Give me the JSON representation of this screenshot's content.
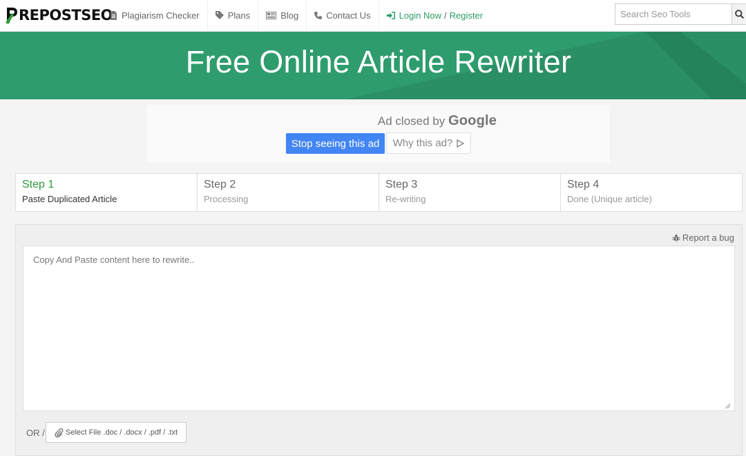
{
  "brand": {
    "logo_text": "REPOSTSEO",
    "logo_mark_color": "#2e9c3a"
  },
  "nav": {
    "items": [
      {
        "label": "Plagiarism Checker",
        "icon": "document-icon"
      },
      {
        "label": "Plans",
        "icon": "tag-icon"
      },
      {
        "label": "Blog",
        "icon": "newspaper-icon"
      },
      {
        "label": "Contact Us",
        "icon": "phone-icon"
      }
    ],
    "login_label": "Login Now",
    "separator": "/",
    "register_label": "Register"
  },
  "search": {
    "placeholder": "Search Seo Tools",
    "value": ""
  },
  "banner": {
    "title": "Free Online Article Rewriter",
    "color": "#2f9c6e"
  },
  "ad": {
    "closed_text": "Ad closed by",
    "brand": "Google",
    "stop_label": "Stop seeing this ad",
    "why_label": "Why this ad?"
  },
  "steps": [
    {
      "title": "Step 1",
      "subtitle": "Paste Duplicated Article",
      "active": true
    },
    {
      "title": "Step 2",
      "subtitle": "Processing",
      "active": false
    },
    {
      "title": "Step 3",
      "subtitle": "Re-writing",
      "active": false
    },
    {
      "title": "Step 4",
      "subtitle": "Done (Unique article)",
      "active": false
    }
  ],
  "editor": {
    "report_label": "Report a bug",
    "placeholder": "Copy And Paste content here to rewrite..",
    "value": "",
    "or_label": "OR /",
    "file_button_label": "Select File .doc / .docx / .pdf / .txt"
  },
  "colors": {
    "accent_green": "#2e9c6a",
    "google_blue": "#4285f4"
  }
}
